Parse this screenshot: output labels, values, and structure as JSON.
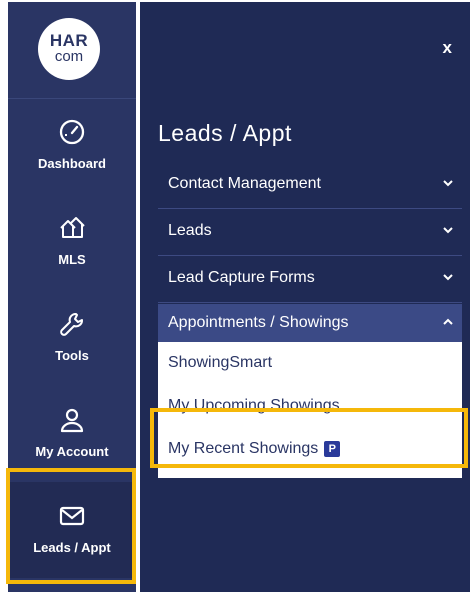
{
  "logo": {
    "line1": "HAR",
    "line2": "com"
  },
  "nav": [
    {
      "label": "Dashboard",
      "icon": "speedometer-icon"
    },
    {
      "label": "MLS",
      "icon": "houses-icon"
    },
    {
      "label": "Tools",
      "icon": "wrench-icon"
    },
    {
      "label": "My Account",
      "icon": "user-icon"
    },
    {
      "label": "Leads / Appt",
      "icon": "envelope-icon",
      "active": true
    }
  ],
  "panel": {
    "close_label": "x",
    "title": "Leads / Appt",
    "sections": [
      {
        "label": "Contact Management",
        "expanded": false
      },
      {
        "label": "Leads",
        "expanded": false
      },
      {
        "label": "Lead Capture Forms",
        "expanded": false
      },
      {
        "label": "Appointments / Showings",
        "expanded": true
      }
    ],
    "submenu": [
      {
        "label": "ShowingSmart"
      },
      {
        "label": "My Upcoming Showings"
      },
      {
        "label": "My Recent Showings",
        "badge": "P"
      }
    ]
  },
  "colors": {
    "rail": "#2a3564",
    "panel": "#1f2a55",
    "highlight": "#f5b80a",
    "badge": "#2a3a9a"
  }
}
